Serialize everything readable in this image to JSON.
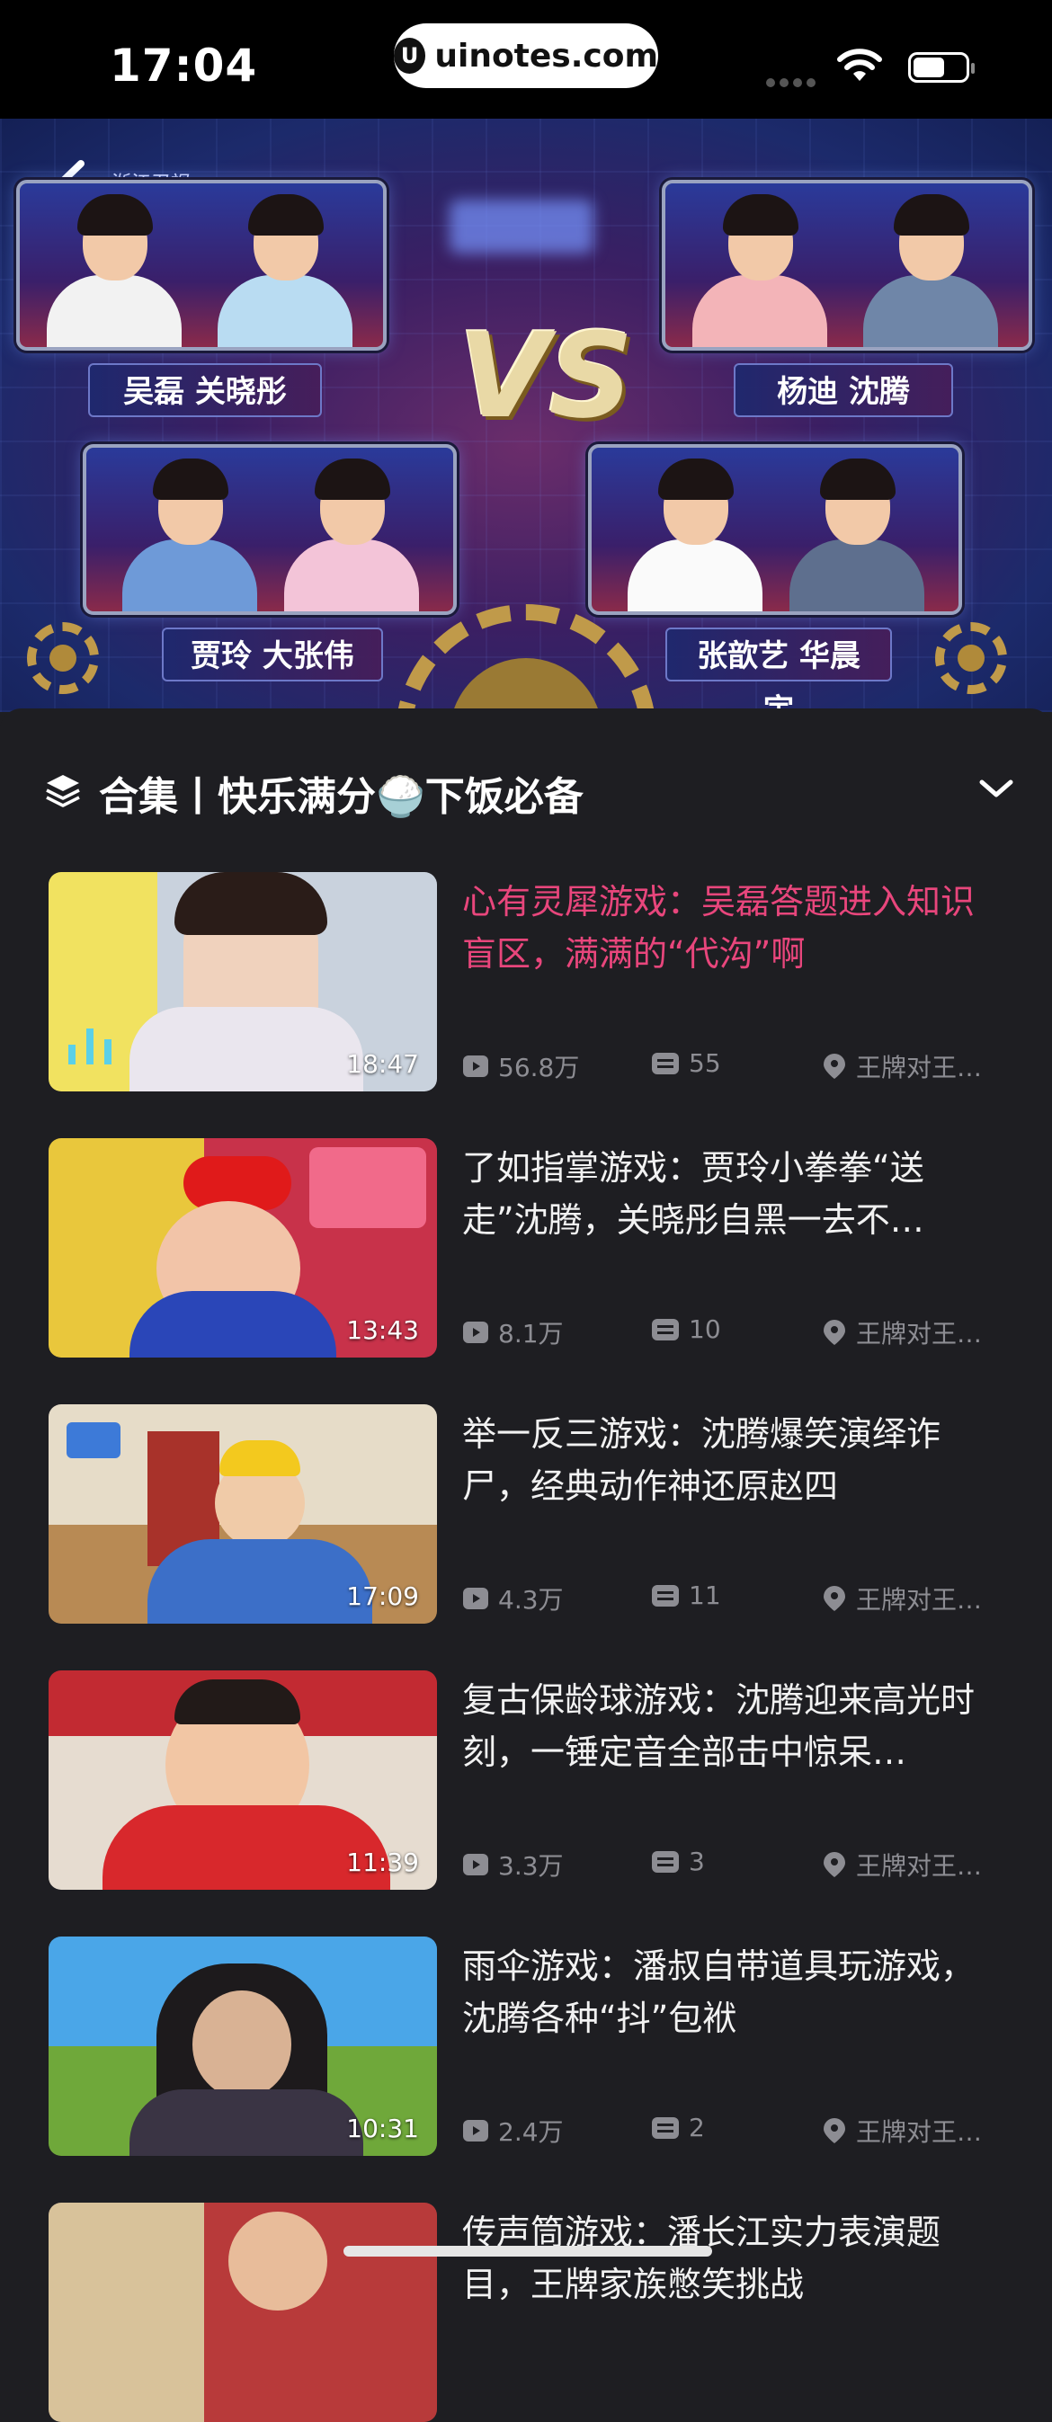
{
  "status_bar": {
    "time": "17:04",
    "url": "uinotes.com"
  },
  "banner": {
    "channel": "浙江卫视",
    "vs": "VS",
    "teams": [
      "吴磊 关晓彤",
      "杨迪 沈腾",
      "贾玲 大张伟",
      "张歆艺 华晨宇"
    ]
  },
  "collection": {
    "title": "合集丨快乐满分🍚下饭必备"
  },
  "videos": [
    {
      "title": "心有灵犀游戏：吴磊答题进入知识盲区，满满的“代沟”啊",
      "duration": "18:47",
      "views": "56.8万",
      "comments": "55",
      "source": "王牌对王…",
      "active": true
    },
    {
      "title": "了如指掌游戏：贾玲小拳拳“送走”沈腾，关晓彤自黑一去不…",
      "duration": "13:43",
      "views": "8.1万",
      "comments": "10",
      "source": "王牌对王…"
    },
    {
      "title": "举一反三游戏：沈腾爆笑演绎诈尸，经典动作神还原赵四",
      "duration": "17:09",
      "views": "4.3万",
      "comments": "11",
      "source": "王牌对王…"
    },
    {
      "title": "复古保龄球游戏：沈腾迎来高光时刻，一锤定音全部击中惊呆…",
      "duration": "11:39",
      "views": "3.3万",
      "comments": "3",
      "source": "王牌对王…"
    },
    {
      "title": "雨伞游戏：潘叔自带道具玩游戏，沈腾各种“抖”包袱",
      "duration": "10:31",
      "views": "2.4万",
      "comments": "2",
      "source": "王牌对王…"
    },
    {
      "title": "传声筒游戏：潘长江实力表演题目，王牌家族憋笑挑战",
      "duration": "",
      "views": "",
      "comments": "",
      "source": ""
    }
  ],
  "colors": {
    "accent": "#e8467c",
    "background": "#1e1e22",
    "meta": "#8d8d93"
  }
}
